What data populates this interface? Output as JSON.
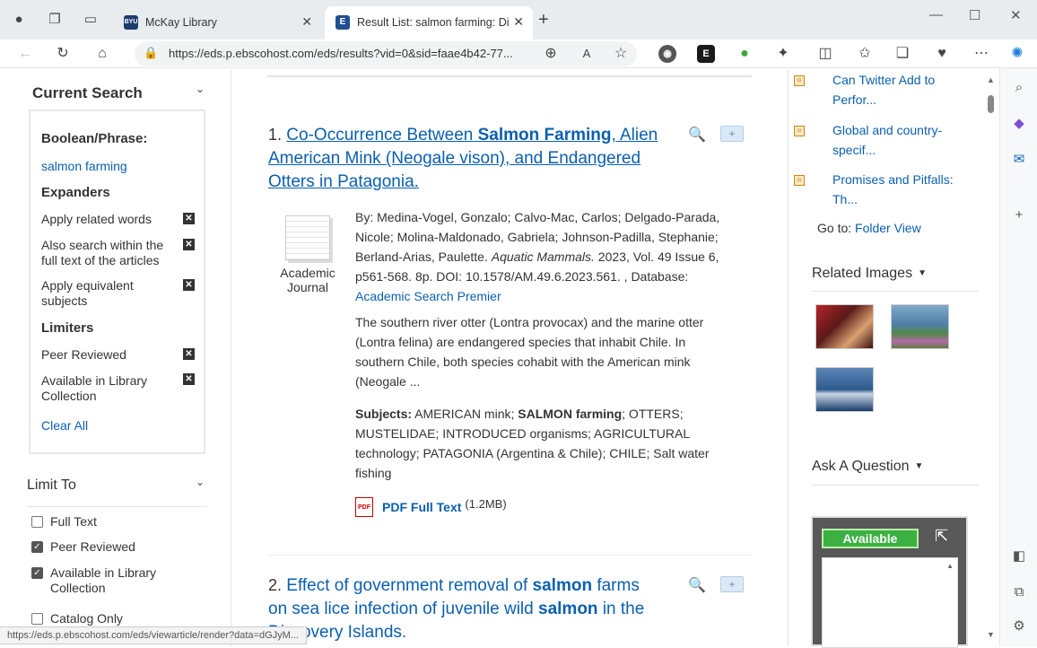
{
  "browser": {
    "tabs": [
      {
        "title": "McKay Library",
        "favicon": "BYU"
      },
      {
        "title": "Result List: salmon farming: Disc",
        "favicon": "E"
      }
    ],
    "url": "https://eds.p.ebscohost.com/eds/results?vid=0&sid=faae4b42-77...",
    "status_url": "https://eds.p.ebscohost.com/eds/viewarticle/render?data=dGJyM..."
  },
  "current_search": {
    "heading": "Current Search",
    "boolean_label": "Boolean/Phrase:",
    "term": "salmon farming",
    "expanders_label": "Expanders",
    "expanders": [
      "Apply related words",
      "Also search within the full text of the articles",
      "Apply equivalent subjects"
    ],
    "limiters_label": "Limiters",
    "limiters": [
      "Peer Reviewed",
      "Available in Library Collection"
    ],
    "clear_all": "Clear All"
  },
  "limit_to": {
    "heading": "Limit To",
    "options": [
      {
        "label": "Full Text",
        "checked": false
      },
      {
        "label": "Peer Reviewed",
        "checked": true
      },
      {
        "label": "Available in Library Collection",
        "checked": true
      },
      {
        "label": "Catalog Only",
        "checked": false
      }
    ]
  },
  "results": [
    {
      "number": "1.",
      "title_parts": [
        "Co-Occurrence Between ",
        "Salmon Farming",
        ", Alien American Mink (Neogale vison), and Endangered Otters in Patagonia."
      ],
      "pubtype": "Academic Journal",
      "byline": "By: Medina-Vogel, Gonzalo; Calvo-Mac, Carlos; Delgado-Parada, Nicole; Molina-Maldonado, Gabriela; Johnson-Padilla, Stephanie; Berland-Arias, Paulette.",
      "journal": "Aquatic Mammals.",
      "citation": "2023, Vol. 49 Issue 6, p561-568. 8p. DOI: 10.1578/AM.49.6.2023.561. , Database:",
      "database": "Academic Search Premier",
      "abstract": "The southern river otter (Lontra provocax) and the marine otter (Lontra felina) are endangered species that inhabit Chile. In southern Chile, both species cohabit with the American mink (Neogale ...",
      "subjects_label": "Subjects:",
      "subjects_parts": [
        "AMERICAN mink; ",
        "SALMON farming",
        "; OTTERS; MUSTELIDAE; INTRODUCED organisms; AGRICULTURAL technology; PATAGONIA (Argentina & Chile); CHILE; Salt water fishing"
      ],
      "pdf_label": "PDF Full Text",
      "pdf_size": "(1.2MB)"
    },
    {
      "number": "2.",
      "title_parts": [
        "Effect of government removal of ",
        "salmon",
        " farms on sea lice infection of juvenile wild ",
        "salmon",
        " in the Discovery Islands."
      ]
    }
  ],
  "related_links": {
    "items": [
      "Can Twitter Add to Perfor...",
      "Global and country-specif...",
      "Promises and Pitfalls: Th..."
    ],
    "goto_label": "Go to:",
    "goto_link": "Folder View"
  },
  "related_images": {
    "heading": "Related Images"
  },
  "ask_question": {
    "heading": "Ask A Question",
    "available": "Available"
  },
  "colors": {
    "link": "#0b5fb0",
    "available_green": "#3cb043"
  }
}
